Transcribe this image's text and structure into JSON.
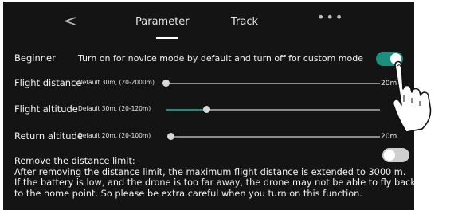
{
  "header": {
    "back_icon": "chevron-left-icon",
    "tabs": [
      {
        "label": "Parameter",
        "active": true
      },
      {
        "label": "Track",
        "active": false
      }
    ],
    "more_label": "•••"
  },
  "beginner": {
    "label": "Beginner",
    "description": "Turn on for novice mode by default and turn off for custom mode",
    "enabled": true
  },
  "sliders": [
    {
      "label": "Flight distance",
      "default": "Default  30m, (20-2000m)",
      "value": "20m",
      "fraction": 0.0
    },
    {
      "label": "Flight altitude",
      "default": "Default  30m, (20-120m)",
      "value": "",
      "fraction": 0.2
    },
    {
      "label": "Return altitude",
      "default": "Default  20m, (20-100m)",
      "value": "20m",
      "fraction": 0.0
    }
  ],
  "distance_limit": {
    "label": "Remove the distance limit:",
    "enabled": false,
    "lines": [
      "After removing the distance limit, the maximum flight distance is extended to 3000 m.",
      "If the battery is low, and the drone is too far away, the drone may not be able to fly back",
      "to the home point. So please be extra careful when you turn on this function."
    ]
  },
  "colors": {
    "accent": "#1a8f7e",
    "panel": "#141414"
  },
  "overlay_icon": "pointing-hand-icon"
}
